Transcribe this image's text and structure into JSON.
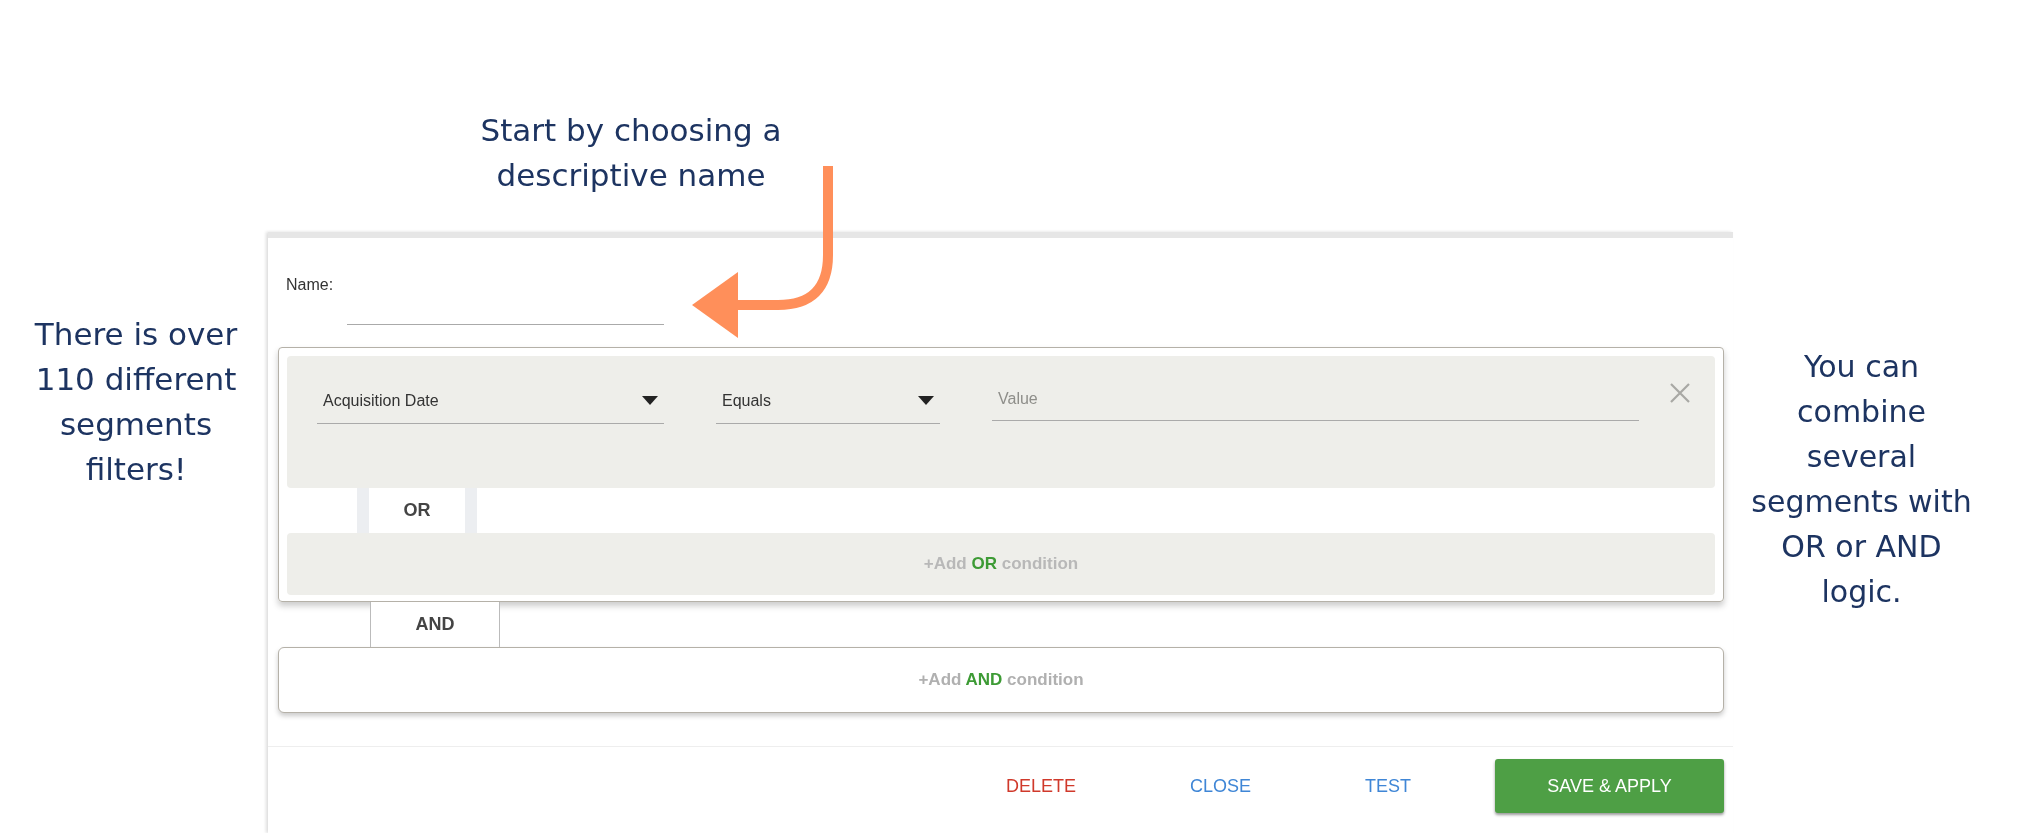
{
  "annotations": {
    "top": "Start by choosing a descriptive name",
    "left": "There is over 110 different segments filters!",
    "right": "You can combine several segments with OR or AND logic."
  },
  "dialog": {
    "name_label": "Name:",
    "conditions": [
      {
        "field": "Acquisition Date",
        "operator": "Equals",
        "placeholder": "Value"
      }
    ],
    "or_label": "OR",
    "add_or": {
      "prefix": "+Add",
      "keyword": "OR",
      "suffix": "condition"
    },
    "and_label": "AND",
    "add_and": {
      "prefix": "+Add",
      "keyword": "AND",
      "suffix": "condition"
    },
    "buttons": [
      {
        "label": "DELETE",
        "kind": "danger"
      },
      {
        "label": "CLOSE",
        "kind": "link"
      },
      {
        "label": "TEST",
        "kind": "link"
      },
      {
        "label": "SAVE & APPLY",
        "kind": "primary"
      }
    ]
  }
}
